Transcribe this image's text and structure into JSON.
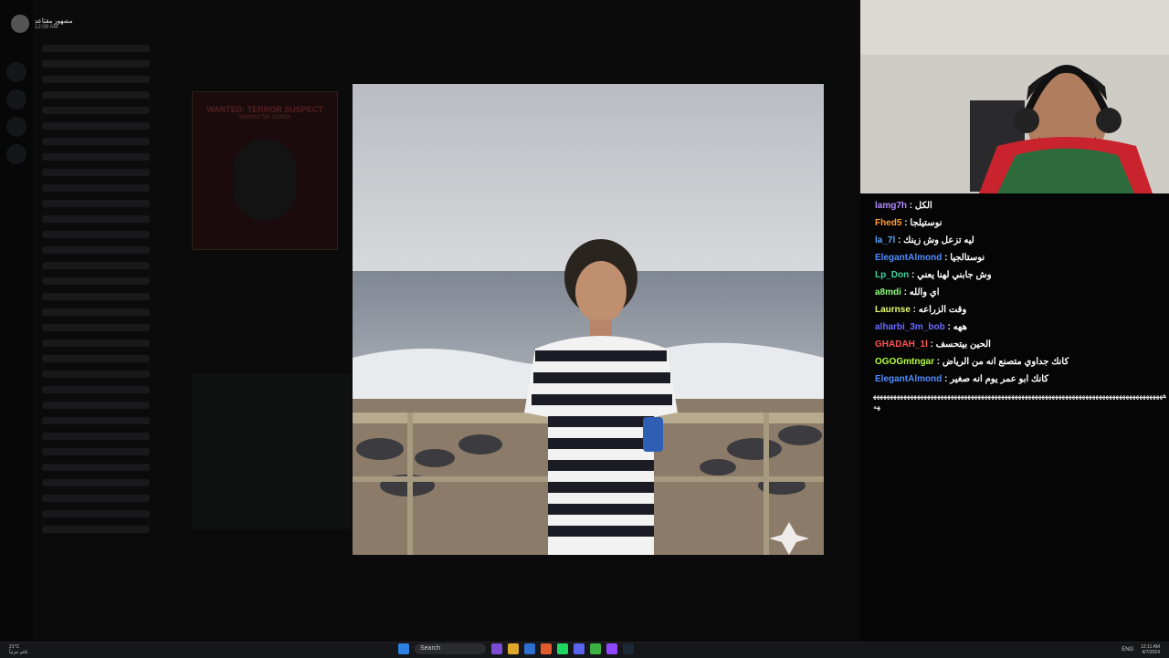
{
  "discord": {
    "header_name": "مشهور مقتاعد",
    "header_time": "12:09 AM",
    "wanted_title": "WANTED: TERROR SUSPECT",
    "wanted_subtitle": "Wanted for Justice"
  },
  "chat": {
    "messages": [
      {
        "user": "lamg7h",
        "color": "#b48bff",
        "text": "الكل"
      },
      {
        "user": "Fhed5",
        "color": "#ff9a3c",
        "text": "نوستيلجا"
      },
      {
        "user": "la_7l",
        "color": "#5aa4ff",
        "text": "ليه تزعل وش زينك"
      },
      {
        "user": "ElegantAlmond",
        "color": "#4f8dff",
        "text": "نوستالجيا"
      },
      {
        "user": "Lp_Don",
        "color": "#39d6a0",
        "text": "وش جابني لهنا يعني"
      },
      {
        "user": "a8mdi",
        "color": "#8bff7a",
        "text": "اي والله"
      },
      {
        "user": "Laurnse",
        "color": "#e6ff66",
        "text": "وقت الزراعه"
      },
      {
        "user": "alharbi_3m_bob",
        "color": "#6a6aff",
        "text": "ههه"
      },
      {
        "user": "GHADAH_1l",
        "color": "#ff5252",
        "text": "الحين بيتحسف"
      },
      {
        "user": "OGOGmtngar",
        "color": "#b6ff3a",
        "text": "كانك جداوي متصنع انه من الرياض"
      },
      {
        "user": "ElegantAlmond",
        "color": "#4f8dff",
        "text": "كانك ابو عمر يوم انه صغير"
      }
    ],
    "spam": "ههههههههههههههههههههههههههههههههههههههههههههههههههههههههههههههههههههههههههههههههههههههههه"
  },
  "taskbar": {
    "temp": "21°C",
    "weather": "غائم جزئياً",
    "search_label": "Search",
    "lang": "ENG",
    "time": "12:11 AM",
    "date": "4/7/2024"
  }
}
